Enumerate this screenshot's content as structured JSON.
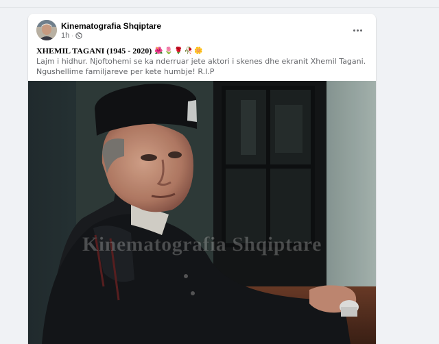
{
  "post": {
    "page_name": "Kinematografia Shqiptare",
    "time": "1h",
    "headline": "XHEMIL TAGANI (1945 - 2020)",
    "emojis": [
      "🌺",
      "🌷",
      "🌹",
      "🥀",
      "🌼"
    ],
    "lines": [
      "Lajm i hidhur. Njoftohemi se ka nderruar jete aktori i skenes dhe ekranit Xhemil Tagani.",
      "Ngushellime familjareve per kete humbje! R.I.P"
    ],
    "watermark": "Kinematografia Shqiptare"
  },
  "icons": {
    "privacy": "globe-icon",
    "menu": "more-options-icon"
  }
}
